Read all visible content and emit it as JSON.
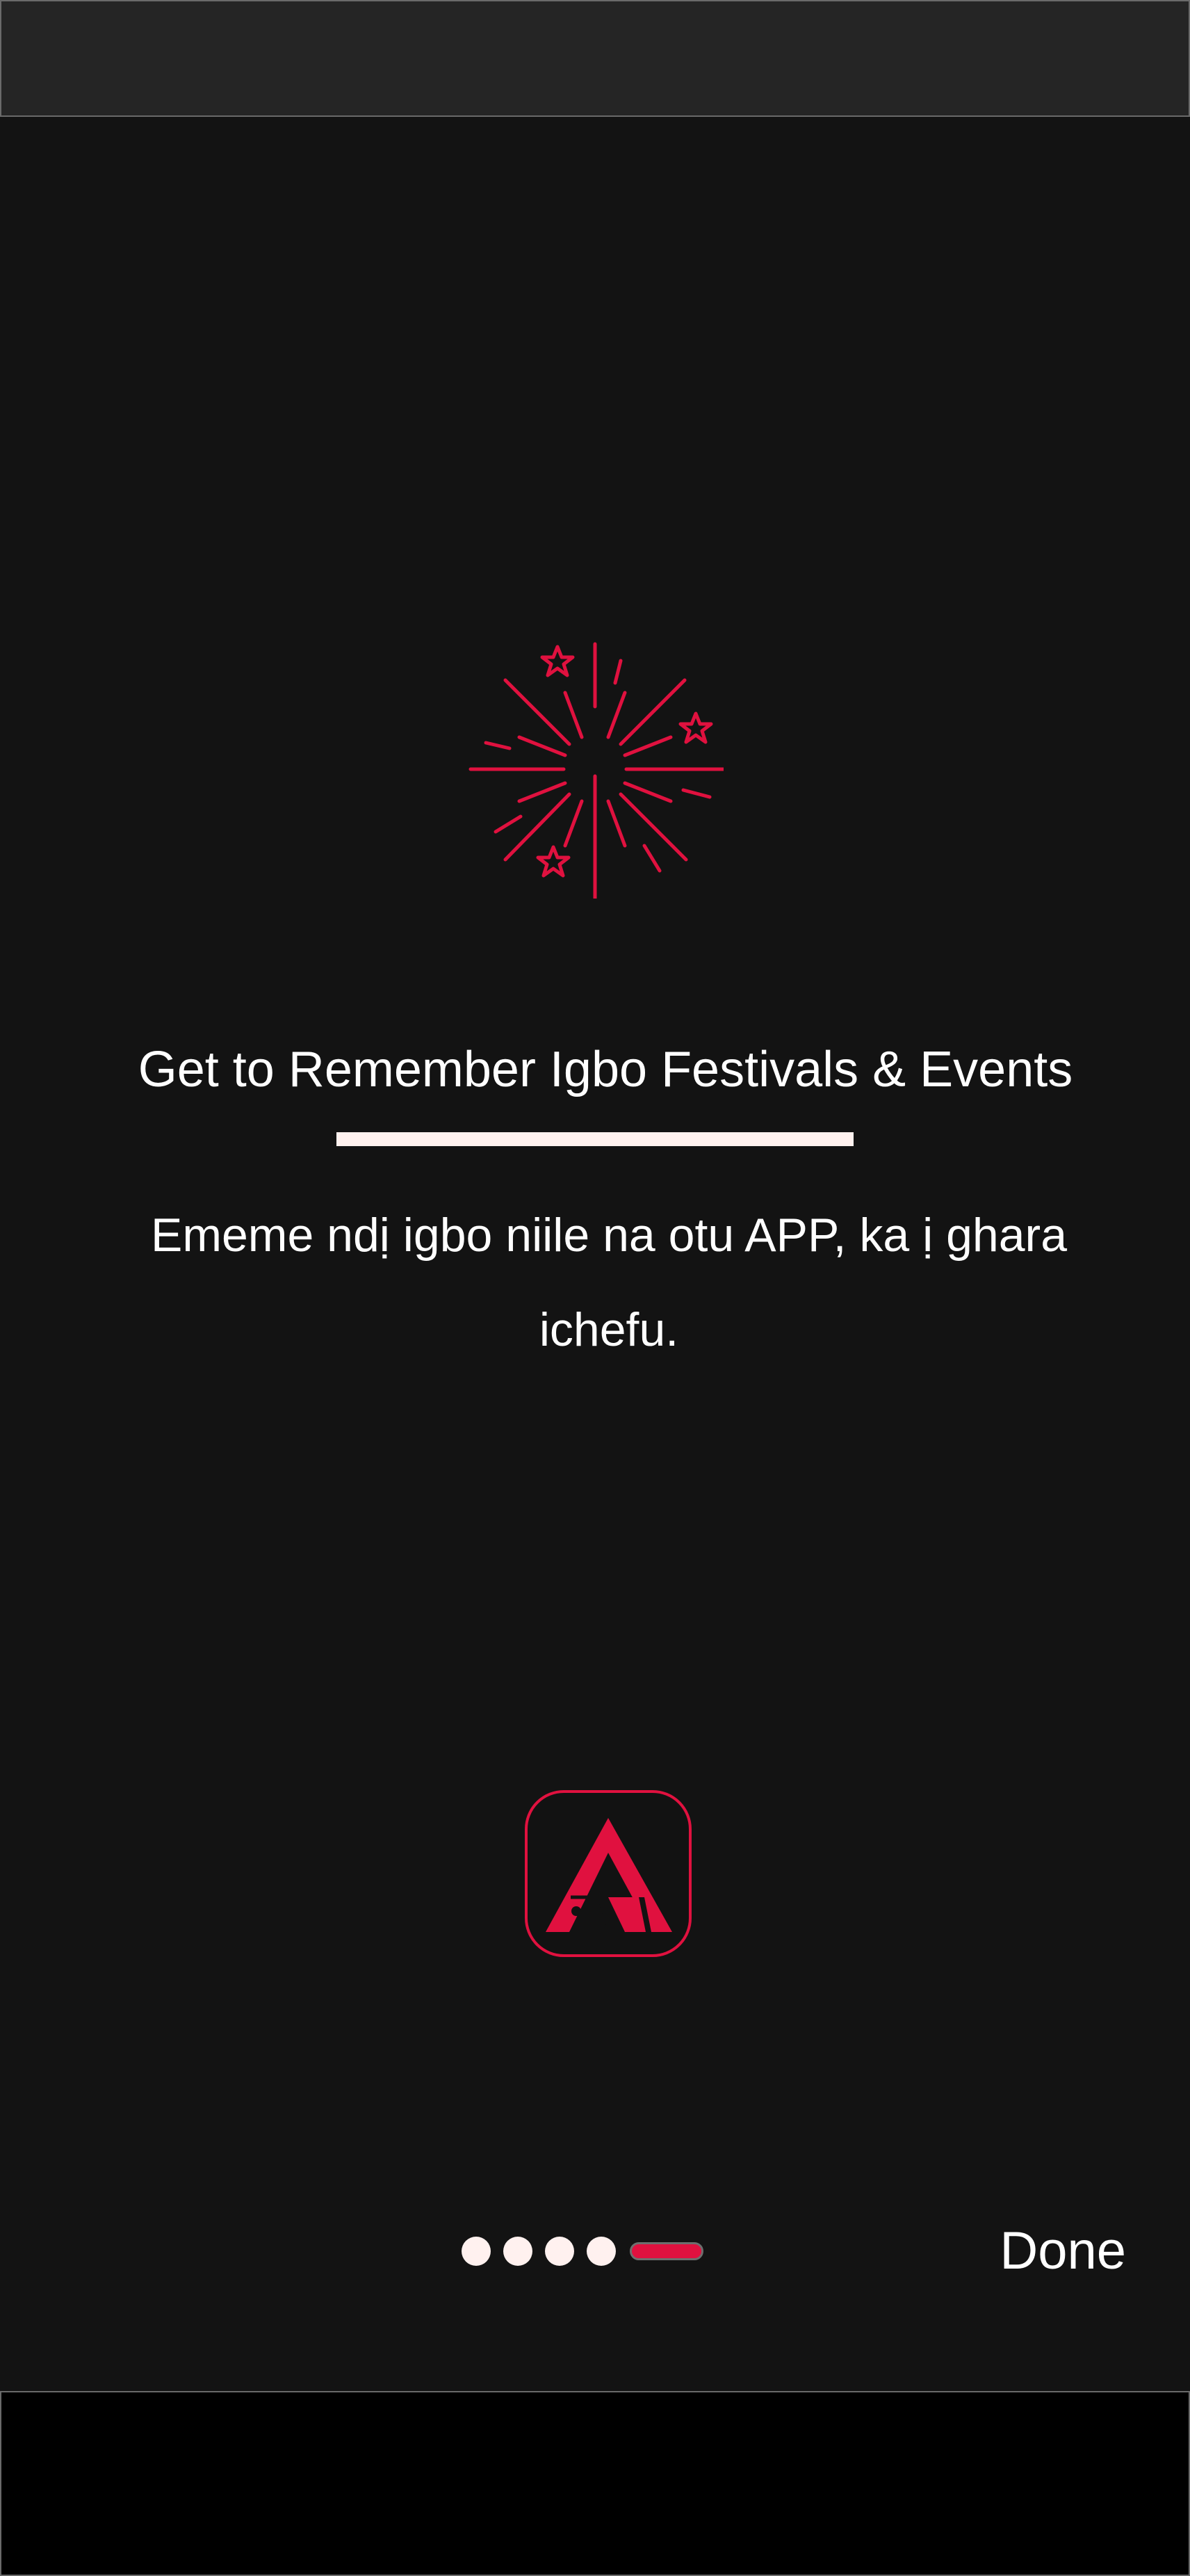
{
  "onboarding": {
    "title": "Get to Remember Igbo Festivals & Events",
    "subtitle": "Ememe ndị igbo niile na otu APP, ka ị ghara ichefu.",
    "hero_icon": "fireworks-icon",
    "logo_icon": "app-logo-icon",
    "done_label": "Done",
    "page_indicator": {
      "total_pages": 5,
      "current_page": 5
    }
  },
  "colors": {
    "background": "#131313",
    "accent": "#e0113f",
    "text": "#ffffff",
    "dot": "#fff1ef"
  }
}
